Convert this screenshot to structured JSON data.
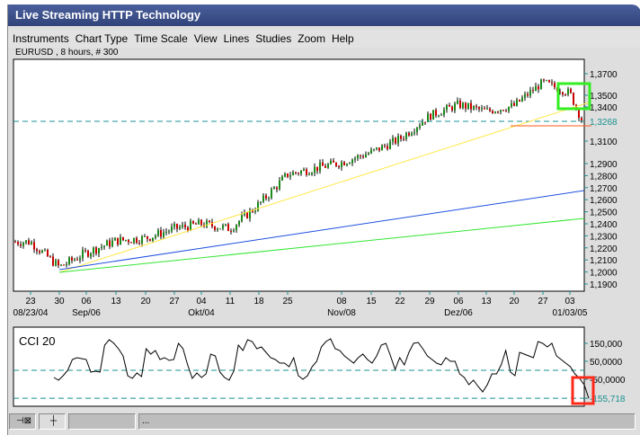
{
  "window": {
    "title": "Live Streaming HTTP Technology"
  },
  "menu": [
    "Instruments",
    "Chart Type",
    "Time Scale",
    "View",
    "Lines",
    "Studies",
    "Zoom",
    "Help"
  ],
  "chart": {
    "instrument_label": "EURUSD , 8 hours, # 300",
    "last_price_label": "1,3268",
    "colors": {
      "up": "#1a8a1a",
      "down": "#cc0000",
      "last_price": "#1a9090",
      "yellow_trend": "#ffe84a",
      "blue_trend": "#1f4fe0",
      "green_trend": "#33e633",
      "orange_line": "#ff5a1a",
      "highlight_green": "#33ee22",
      "highlight_red": "#ff2a1a"
    }
  },
  "chart_data": [
    {
      "type": "candlestick",
      "y_ticks": [
        "1,3700",
        "1,3500",
        "1,3400",
        "1,3100",
        "1,2900",
        "1,2800",
        "1,2700",
        "1,2600",
        "1,2500",
        "1,2400",
        "1,2300",
        "1,2200",
        "1,2100",
        "1,2000",
        "1,1900"
      ],
      "x_ticks": [
        "23",
        "30",
        "06",
        "13",
        "20",
        "27",
        "04",
        "11",
        "18",
        "25",
        "08",
        "15",
        "22",
        "29",
        "06",
        "13",
        "20",
        "27",
        "03"
      ],
      "x_major_labels": [
        "08/23/04",
        "Sep/06",
        "Okt/04",
        "Nov/08",
        "Dez/06",
        "01/03/05"
      ],
      "approx_close_at_ticks": [
        1.225,
        1.204,
        1.216,
        1.226,
        1.228,
        1.236,
        1.24,
        1.236,
        1.256,
        1.281,
        1.291,
        1.3,
        1.312,
        1.332,
        1.342,
        1.336,
        1.341,
        1.362,
        1.352
      ],
      "last_close": 1.3268,
      "trendlines": [
        {
          "color": "yellow",
          "from": [
            "30",
            1.2
          ],
          "to": [
            "03",
            1.35
          ]
        },
        {
          "color": "blue",
          "from": [
            "30",
            1.202
          ],
          "to": [
            "03",
            1.268
          ]
        },
        {
          "color": "green",
          "from": [
            "30",
            1.2
          ],
          "to": [
            "03",
            1.241
          ]
        },
        {
          "color": "orange",
          "level": 1.323,
          "from": "20"
        },
        {
          "color": "teal-dashed",
          "level": 1.3268
        }
      ]
    },
    {
      "type": "line",
      "title": "CCI 20",
      "y_ticks": [
        "150,000",
        "50,0000",
        "-50,0000",
        "-155,718"
      ],
      "dashed_levels": [
        0,
        -155.718
      ],
      "values": [
        -40,
        -55,
        -30,
        0,
        60,
        70,
        65,
        60,
        -10,
        -5,
        -10,
        140,
        170,
        150,
        120,
        80,
        -30,
        -45,
        -15,
        -35,
        120,
        90,
        110,
        60,
        70,
        55,
        60,
        150,
        120,
        30,
        -45,
        -15,
        -40,
        -20,
        90,
        80,
        -10,
        -40,
        -55,
        -5,
        140,
        110,
        170,
        160,
        120,
        130,
        100,
        70,
        60,
        40,
        40,
        20,
        70,
        -30,
        -50,
        -30,
        20,
        50,
        130,
        160,
        175,
        120,
        110,
        80,
        60,
        40,
        70,
        90,
        60,
        40,
        80,
        140,
        150,
        80,
        5,
        70,
        30,
        100,
        150,
        155,
        120,
        80,
        60,
        40,
        30,
        70,
        50,
        50,
        -20,
        -40,
        -80,
        -55,
        -90,
        -120,
        -80,
        -20,
        -20,
        30,
        110,
        -10,
        -30,
        100,
        90,
        80,
        70,
        160,
        150,
        130,
        150,
        80,
        60,
        40,
        20,
        -20,
        -45,
        -80,
        -155.718
      ]
    }
  ],
  "status": {
    "pin_icon": "pin-icon",
    "crosshair_icon": "crosshair-icon",
    "message": "..."
  }
}
